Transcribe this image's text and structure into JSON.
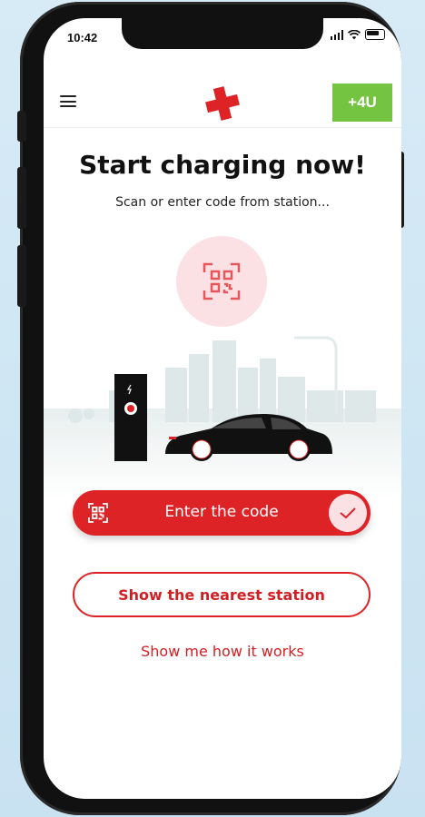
{
  "status_bar": {
    "time": "10:42",
    "icons": [
      "signal-icon",
      "wifi-icon",
      "battery-icon"
    ]
  },
  "header": {
    "menu_icon": "hamburger-menu-icon",
    "logo_icon": "red-cross-logo",
    "badge_label": "+4U"
  },
  "main": {
    "title": "Start charging now!",
    "subtitle": "Scan or enter code from station...",
    "qr_icon": "qr-code-icon",
    "illustration": "charging-station-with-car"
  },
  "actions": {
    "enter_code_label": "Enter the code",
    "nearest_station_label": "Show the nearest station",
    "how_it_works_label": "Show me how it works"
  },
  "colors": {
    "accent": "#de2326",
    "badge": "#74c442",
    "soft_pink": "#fbe1e4",
    "background": "#cfe6f3"
  }
}
